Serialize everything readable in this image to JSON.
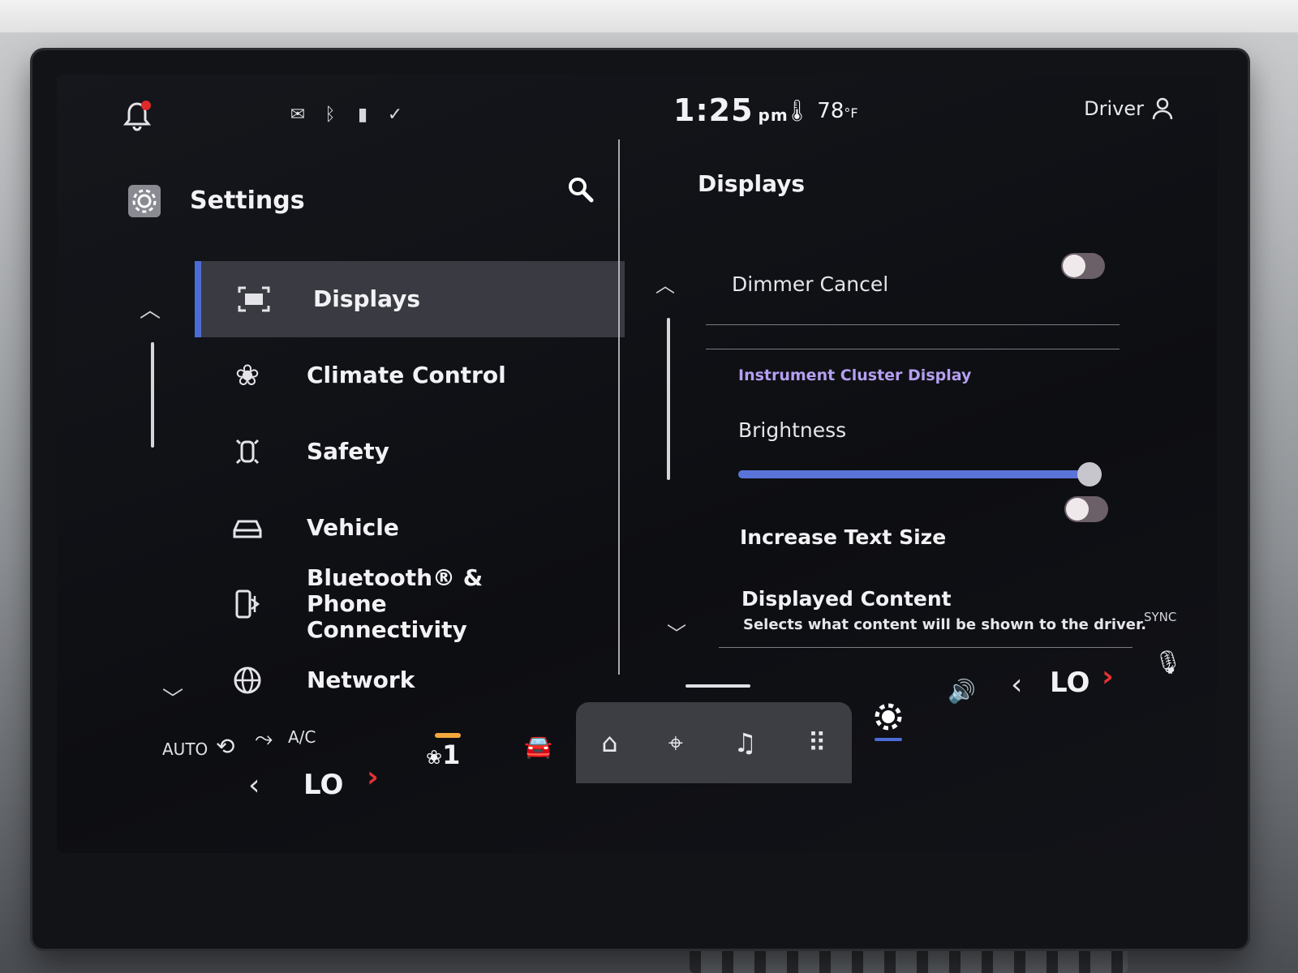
{
  "status": {
    "time": "1:25",
    "ampm": "pm",
    "temperature": "78",
    "temp_unit": "°F",
    "user": "Driver"
  },
  "left_panel": {
    "title": "Settings",
    "items": [
      {
        "label": "Displays",
        "icon": "display-icon",
        "active": true
      },
      {
        "label": "Climate Control",
        "icon": "climate-icon",
        "active": false
      },
      {
        "label": "Safety",
        "icon": "safety-icon",
        "active": false
      },
      {
        "label": "Vehicle",
        "icon": "car-icon",
        "active": false
      },
      {
        "label": "Bluetooth® & Phone Connectivity",
        "icon": "phone-bluetooth-icon",
        "active": false
      },
      {
        "label": "Network",
        "icon": "globe-icon",
        "active": false
      }
    ]
  },
  "right_panel": {
    "title": "Displays",
    "dimmer_cancel": {
      "label": "Dimmer Cancel",
      "enabled": false
    },
    "section_header": "Instrument Cluster Display",
    "brightness": {
      "label": "Brightness",
      "level": 1.0
    },
    "increase_text_size": {
      "label": "Increase Text Size",
      "enabled": false
    },
    "displayed_content": {
      "label": "Displayed Content",
      "description": "Selects what content will be shown to the driver."
    },
    "sync_label": "SYNC"
  },
  "bottom": {
    "auto_label": "AUTO",
    "ac_label": "A/C",
    "left_temp": "LO",
    "right_temp": "LO",
    "fan_speed": "1"
  },
  "colors": {
    "accent": "#4b6bd6",
    "header_purple": "#b59ff0",
    "alert_red": "#e02a2a",
    "temp_red": "#e63232",
    "fan_orange": "#f2a93b"
  }
}
